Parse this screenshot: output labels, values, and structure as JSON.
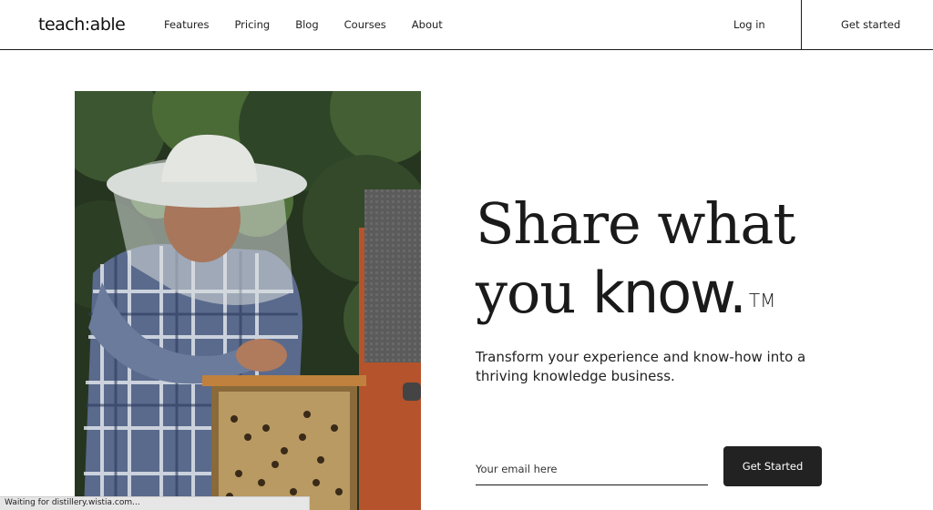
{
  "header": {
    "logo": "teach:able",
    "nav": [
      "Features",
      "Pricing",
      "Blog",
      "Courses",
      "About"
    ],
    "login": "Log in",
    "get_started": "Get started"
  },
  "hero": {
    "headline_line1": "Share what",
    "headline_line2_plain": "you ",
    "headline_line2_emph": "know.",
    "trademark": "TM",
    "subhead": "Transform your experience and know-how into a thriving knowledge business.",
    "email_placeholder": "Your email here",
    "cta_label": "Get Started",
    "image_icon": "beekeeper-photo"
  },
  "status_bar": {
    "text": "Waiting for distillery.wistia.com..."
  },
  "colors": {
    "button_bg": "#222222",
    "text": "#1a1a1a",
    "background": "#ffffff"
  }
}
